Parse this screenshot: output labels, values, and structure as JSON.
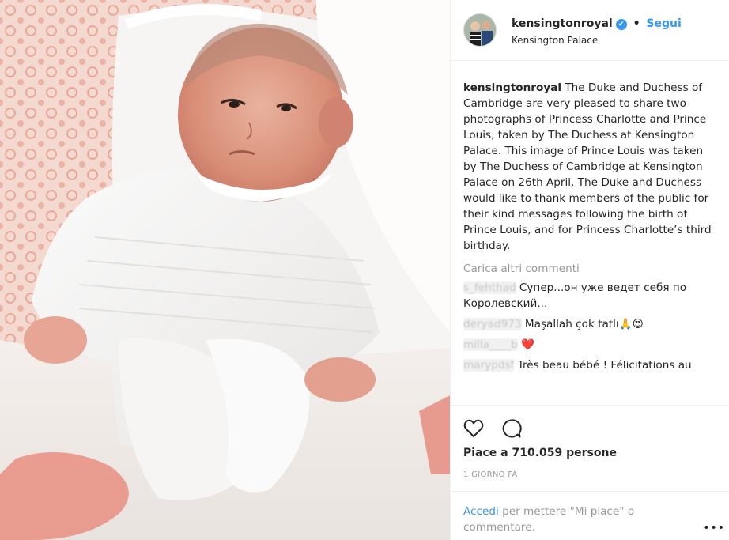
{
  "post": {
    "photo_alt": "baby in white knitted outfit on pillow"
  },
  "header": {
    "username": "kensingtonroyal",
    "verified_glyph": "✔",
    "separator": "•",
    "follow_label": "Segui",
    "location": "Kensington Palace"
  },
  "caption": {
    "username": "kensingtonroyal",
    "text": "The Duke and Duchess of Cambridge are very pleased to share two photographs of Princess Charlotte and Prince Louis, taken by The Duchess at Kensington Palace. This image of Prince Louis was taken by The Duchess of Cambridge at Kensington Palace on 26th April. The Duke and Duchess would like to thank members of the public for their kind messages following the birth of Prince Louis, and for Princess Charlotte’s third birthday."
  },
  "load_more_label": "Carica altri commenti",
  "comments": [
    {
      "username": "s_fehthad",
      "text": "Супер...он уже ведет себя по Королевский..."
    },
    {
      "username": "deryad973",
      "text": "Maşallah çok tatlı🙏😍"
    },
    {
      "username": "milla____b",
      "text": "❤️"
    },
    {
      "username": "marypdsf",
      "text": "Très beau bébé ! Félicitations au"
    }
  ],
  "actions": {
    "like_icon": "heart-outline-icon",
    "comment_icon": "speech-bubble-icon",
    "likes_text": "Piace a 710.059 persone",
    "time_text": "1 GIORNO FA"
  },
  "login": {
    "link_label": "Accedi",
    "rest_text": "per mettere \"Mi piace\" o commentare.",
    "more_glyph": "•••"
  },
  "colors": {
    "accent": "#3897f0",
    "text": "#262626",
    "muted": "#999999",
    "heart": "#ed4956"
  }
}
